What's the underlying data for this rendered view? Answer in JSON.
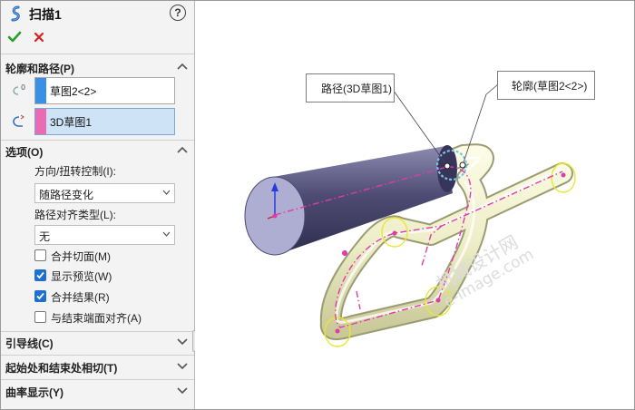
{
  "feature": {
    "title": "扫描1",
    "help_label": "?"
  },
  "actions": {
    "ok_icon": "check-icon",
    "cancel_icon": "close-icon"
  },
  "profile_path": {
    "header": "轮廓和路径(P)",
    "profile": {
      "value": "草图2<2>",
      "color": "#3a8fe6"
    },
    "path": {
      "value": "3D草图1",
      "color": "#ea6bb3"
    }
  },
  "options": {
    "header": "选项(O)",
    "orientation_label": "方向/扭转控制(I):",
    "orientation_value": "随路径变化",
    "alignment_label": "路径对齐类型(L):",
    "alignment_value": "无",
    "checkboxes": [
      {
        "label": "合并切面(M)",
        "checked": false
      },
      {
        "label": "显示预览(W)",
        "checked": true
      },
      {
        "label": "合并结果(R)",
        "checked": true
      },
      {
        "label": "与结束端面对齐(A)",
        "checked": false
      }
    ]
  },
  "collapsed_sections": [
    "引导线(C)",
    "起始处和结束处相切(T)",
    "曲率显示(Y)"
  ],
  "viewport": {
    "callout_path": "路径(3D草图1)",
    "callout_profile": "轮廓(草图2<2>)",
    "watermarks": [
      "机械设计网",
      "e-image.com"
    ],
    "colors": {
      "sweep_body": "#4a4870",
      "path": "#e03aa8",
      "guide": "#e6e6b0"
    }
  }
}
